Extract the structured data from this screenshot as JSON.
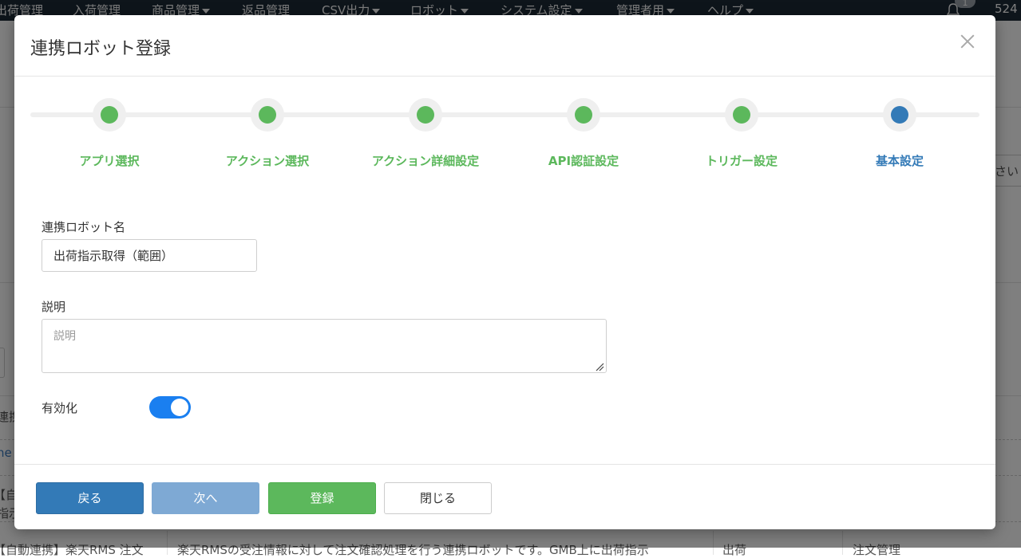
{
  "topnav": {
    "items": [
      {
        "label": "出荷管理",
        "caret": false
      },
      {
        "label": "入荷管理",
        "caret": false
      },
      {
        "label": "商品管理",
        "caret": true
      },
      {
        "label": "返品管理",
        "caret": false
      },
      {
        "label": "CSV出力",
        "caret": true
      },
      {
        "label": "ロボット",
        "caret": true
      },
      {
        "label": "システム設定",
        "caret": true
      },
      {
        "label": "管理者用",
        "caret": true
      },
      {
        "label": "ヘルプ",
        "caret": true
      }
    ],
    "notification_count": "1",
    "user_id": "524"
  },
  "background": {
    "right_input_fragment": "さい",
    "row_label_fragment": "連携",
    "link_fragment": "ne",
    "row_fragment_1": "【自",
    "row_fragment_2": "指示",
    "bottom_row_text": "【自動連携】楽天RMS 注文",
    "bottom_row_desc": "楽天RMSの受注情報に対して注文確認処理を行う連携ロボットです。GMB上に出荷指示",
    "bottom_row_col3": "出荷",
    "bottom_row_col4": "注文管理"
  },
  "modal": {
    "title": "連携ロボット登録",
    "steps": [
      {
        "label": "アプリ選択",
        "status": "done"
      },
      {
        "label": "アクション選択",
        "status": "done"
      },
      {
        "label": "アクション詳細設定",
        "status": "done"
      },
      {
        "label": "API認証設定",
        "status": "done"
      },
      {
        "label": "トリガー設定",
        "status": "done"
      },
      {
        "label": "基本設定",
        "status": "current"
      }
    ],
    "form": {
      "name_label": "連携ロボット名",
      "name_value": "出荷指示取得（範囲）",
      "description_label": "説明",
      "description_placeholder": "説明",
      "description_value": "",
      "enabled_label": "有効化",
      "enabled": true
    },
    "footer": {
      "back_label": "戻る",
      "next_label": "次へ",
      "register_label": "登録",
      "close_label": "閉じる"
    }
  },
  "colors": {
    "step_done": "#5cb85c",
    "step_current": "#337ab7",
    "toggle_on": "#1a7ff0",
    "nav_bg": "#1c2b36"
  }
}
